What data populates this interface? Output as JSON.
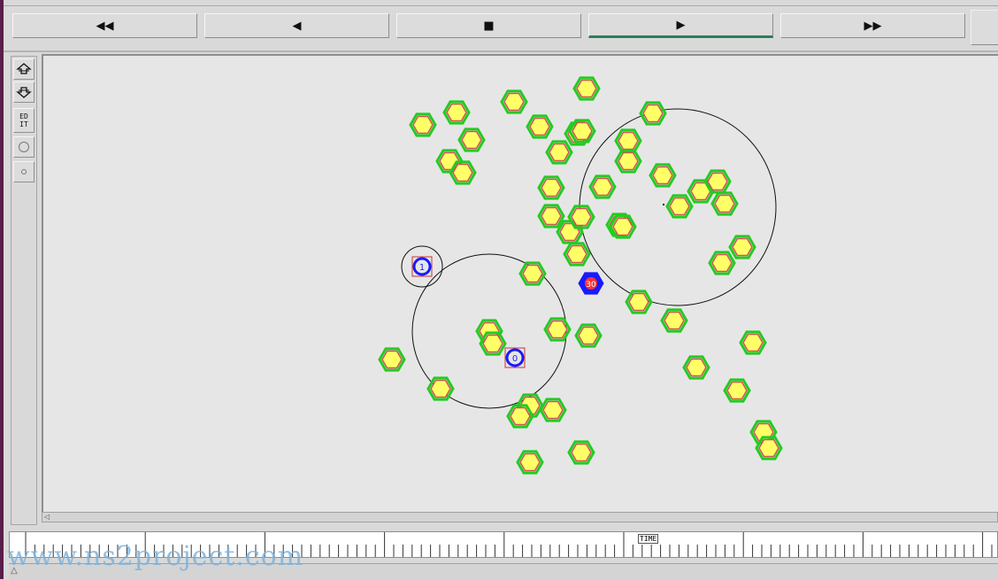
{
  "toolbar": {
    "buttons": [
      {
        "glyph": "◀◀",
        "icon": "rewind-icon"
      },
      {
        "glyph": "◀",
        "icon": "step-back-icon"
      },
      {
        "glyph": "■",
        "icon": "stop-icon"
      },
      {
        "glyph": "▶",
        "icon": "play-icon"
      },
      {
        "glyph": "▶▶",
        "icon": "fast-forward-icon"
      }
    ],
    "active_index": 3
  },
  "sidebar": {
    "edit_label": "ED\nIT"
  },
  "timeline": {
    "time_label": "TIME"
  },
  "watermark": "www.ns2project.com",
  "colors": {
    "node_fill": "#ffff66",
    "node_ring": "#22cc22",
    "node_inner": "#cc5555",
    "highlight_node": "#1a1aff",
    "highlight_label": "#ff3333",
    "range_circle": "#111111"
  },
  "network": {
    "highlighted_nodes": [
      {
        "label": "1"
      },
      {
        "label": "0"
      },
      {
        "label": "30"
      }
    ]
  }
}
